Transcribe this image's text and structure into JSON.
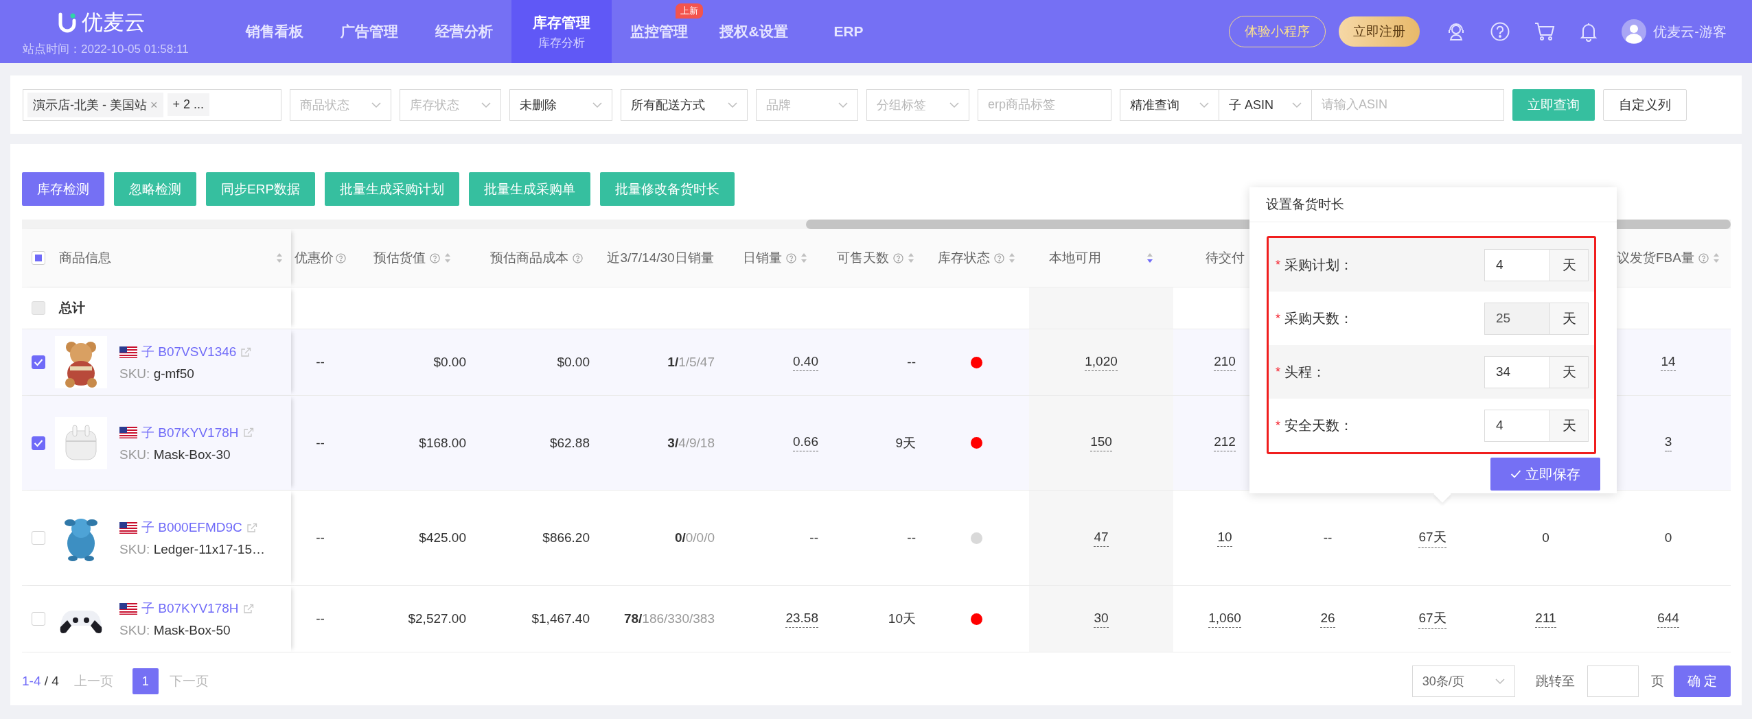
{
  "nav": {
    "logo": "优麦云",
    "station_time": "站点时间：2022-10-05 01:58:11",
    "items": [
      {
        "label": "销售看板",
        "selected": false
      },
      {
        "label": "广告管理",
        "selected": false
      },
      {
        "label": "经营分析",
        "selected": false
      },
      {
        "label": "库存管理",
        "selected": true,
        "sub": "库存分析"
      },
      {
        "label": "监控管理",
        "selected": false,
        "badge": "上新"
      },
      {
        "label": "授权&设置",
        "selected": false
      },
      {
        "label": "ERP",
        "selected": false
      }
    ],
    "trial_button": "体验小程序",
    "register_button": "立即注册",
    "user": "优麦云-游客"
  },
  "filters": {
    "store_chips": [
      {
        "label": "演示店-北美 - 美国站",
        "remove": "×"
      },
      {
        "label": "+ 2 ..."
      }
    ],
    "controls": [
      {
        "kind": "select",
        "placeholder": "商品状态"
      },
      {
        "kind": "select",
        "placeholder": "库存状态"
      },
      {
        "kind": "select",
        "value": "未删除"
      },
      {
        "kind": "select",
        "value": "所有配送方式"
      },
      {
        "kind": "select",
        "placeholder": "品牌"
      },
      {
        "kind": "select",
        "placeholder": "分组标签"
      },
      {
        "kind": "input",
        "placeholder": "erp商品标签"
      }
    ],
    "search": {
      "mode": "精准查询",
      "field": "子 ASIN",
      "placeholder": "请输入ASIN"
    },
    "query_button": "立即查询",
    "columns_button": "自定义列"
  },
  "actions": [
    {
      "label": "库存检测",
      "primary": true
    },
    {
      "label": "忽略检测",
      "primary": false
    },
    {
      "label": "同步ERP数据",
      "primary": false
    },
    {
      "label": "批量生成采购计划",
      "primary": false
    },
    {
      "label": "批量生成采购单",
      "primary": false
    },
    {
      "label": "批量修改备货时长",
      "primary": false
    }
  ],
  "table": {
    "select_all_partial": true,
    "product_column": {
      "label": "商品信息",
      "sortable": true
    },
    "columns": [
      {
        "label": "优惠价",
        "help": true
      },
      {
        "label": "预估货值",
        "help": true,
        "sortable": true,
        "sorted": false
      },
      {
        "label": "预估商品成本",
        "help": true
      },
      {
        "label": "近3/7/14/30日销量"
      },
      {
        "label": "日销量",
        "help": true,
        "sortable": true,
        "sorted": false
      },
      {
        "label": "可售天数",
        "help": true,
        "sortable": true,
        "sorted": false
      },
      {
        "label": "库存状态",
        "help": true,
        "sortable": true,
        "sorted": false
      },
      {
        "label": "本地可用",
        "sortable": true,
        "sorted": true
      },
      {
        "label": "待交付"
      },
      {},
      {},
      {},
      {
        "label": "议发货FBA量",
        "help": true,
        "sortable": true,
        "sorted": false
      }
    ],
    "total_label": "总计",
    "total_checkbox": {
      "checked": false,
      "disabled": true
    },
    "rows": [
      {
        "checked": true,
        "asin": "子 B07VSV1346",
        "sku_label": "SKU:",
        "sku": "g-mf50",
        "cells": [
          "--",
          "$0.00",
          "$0.00",
          "**1/**1/5/47",
          {
            "text": "0.40",
            "dotted": true
          },
          "--",
          {
            "color": "#ff0000"
          },
          {
            "text": "1,020",
            "dotted": true
          },
          {
            "text": "210",
            "dotted": true
          },
          null,
          null,
          null,
          {
            "text": "14",
            "dotted": true
          }
        ]
      },
      {
        "checked": true,
        "asin": "子 B07KYV178H",
        "sku_label": "SKU:",
        "sku": "Mask-Box-30",
        "cells": [
          "--",
          "$168.00",
          "$62.88",
          "**3/**4/9/18",
          {
            "text": "0.66",
            "dotted": true
          },
          "9天",
          {
            "color": "#ff0000"
          },
          {
            "text": "150",
            "dotted": true
          },
          {
            "text": "212",
            "dotted": true
          },
          null,
          null,
          null,
          {
            "text": "3",
            "dotted": true
          }
        ]
      },
      {
        "checked": false,
        "asin": "子 B000EFMD9C",
        "sku_label": "SKU:",
        "sku": "Ledger-11x17-15…",
        "cells": [
          "--",
          "$425.00",
          "$866.20",
          "**0/**0/0/0",
          "--",
          "--",
          {
            "color": "#d9d9d9"
          },
          {
            "text": "47",
            "dotted": true
          },
          {
            "text": "10",
            "dotted": true
          },
          "--",
          {
            "text": "67天",
            "dotted": true
          },
          "0",
          "0"
        ]
      },
      {
        "checked": false,
        "asin": "子 B07KYV178H",
        "sku_label": "SKU:",
        "sku": "Mask-Box-50",
        "cells": [
          "--",
          "$2,527.00",
          "$1,467.40",
          "**78/**186/330/383",
          {
            "text": "23.58",
            "dotted": true
          },
          "10天",
          {
            "color": "#ff0000"
          },
          {
            "text": "30",
            "dotted": true
          },
          {
            "text": "1,060",
            "dotted": true
          },
          {
            "text": "26",
            "dotted": true
          },
          {
            "text": "67天",
            "dotted": true
          },
          {
            "text": "211",
            "dotted": true
          },
          {
            "text": "644",
            "dotted": true
          }
        ]
      }
    ]
  },
  "pagination": {
    "range": "1-4",
    "total": "/ 4",
    "prev": {
      "label": "上一页",
      "disabled": true
    },
    "pages": [
      {
        "label": "1",
        "selected": true
      }
    ],
    "next": {
      "label": "下一页",
      "disabled": true
    },
    "page_size": "30条/页",
    "jump_label": "跳转至",
    "page_unit": "页",
    "confirm": "确 定"
  },
  "popup": {
    "title": "设置备货时长",
    "required_mark": "*",
    "fields": [
      {
        "label": "采购计划：",
        "value": "4",
        "unit": "天",
        "required": true,
        "disabled": false
      },
      {
        "label": "采购天数：",
        "value": "25",
        "unit": "天",
        "required": true,
        "disabled": true
      },
      {
        "label": "头程：",
        "value": "34",
        "unit": "天",
        "required": true,
        "disabled": false
      },
      {
        "label": "安全天数：",
        "value": "4",
        "unit": "天",
        "required": true,
        "disabled": false
      }
    ],
    "save": "立即保存"
  }
}
